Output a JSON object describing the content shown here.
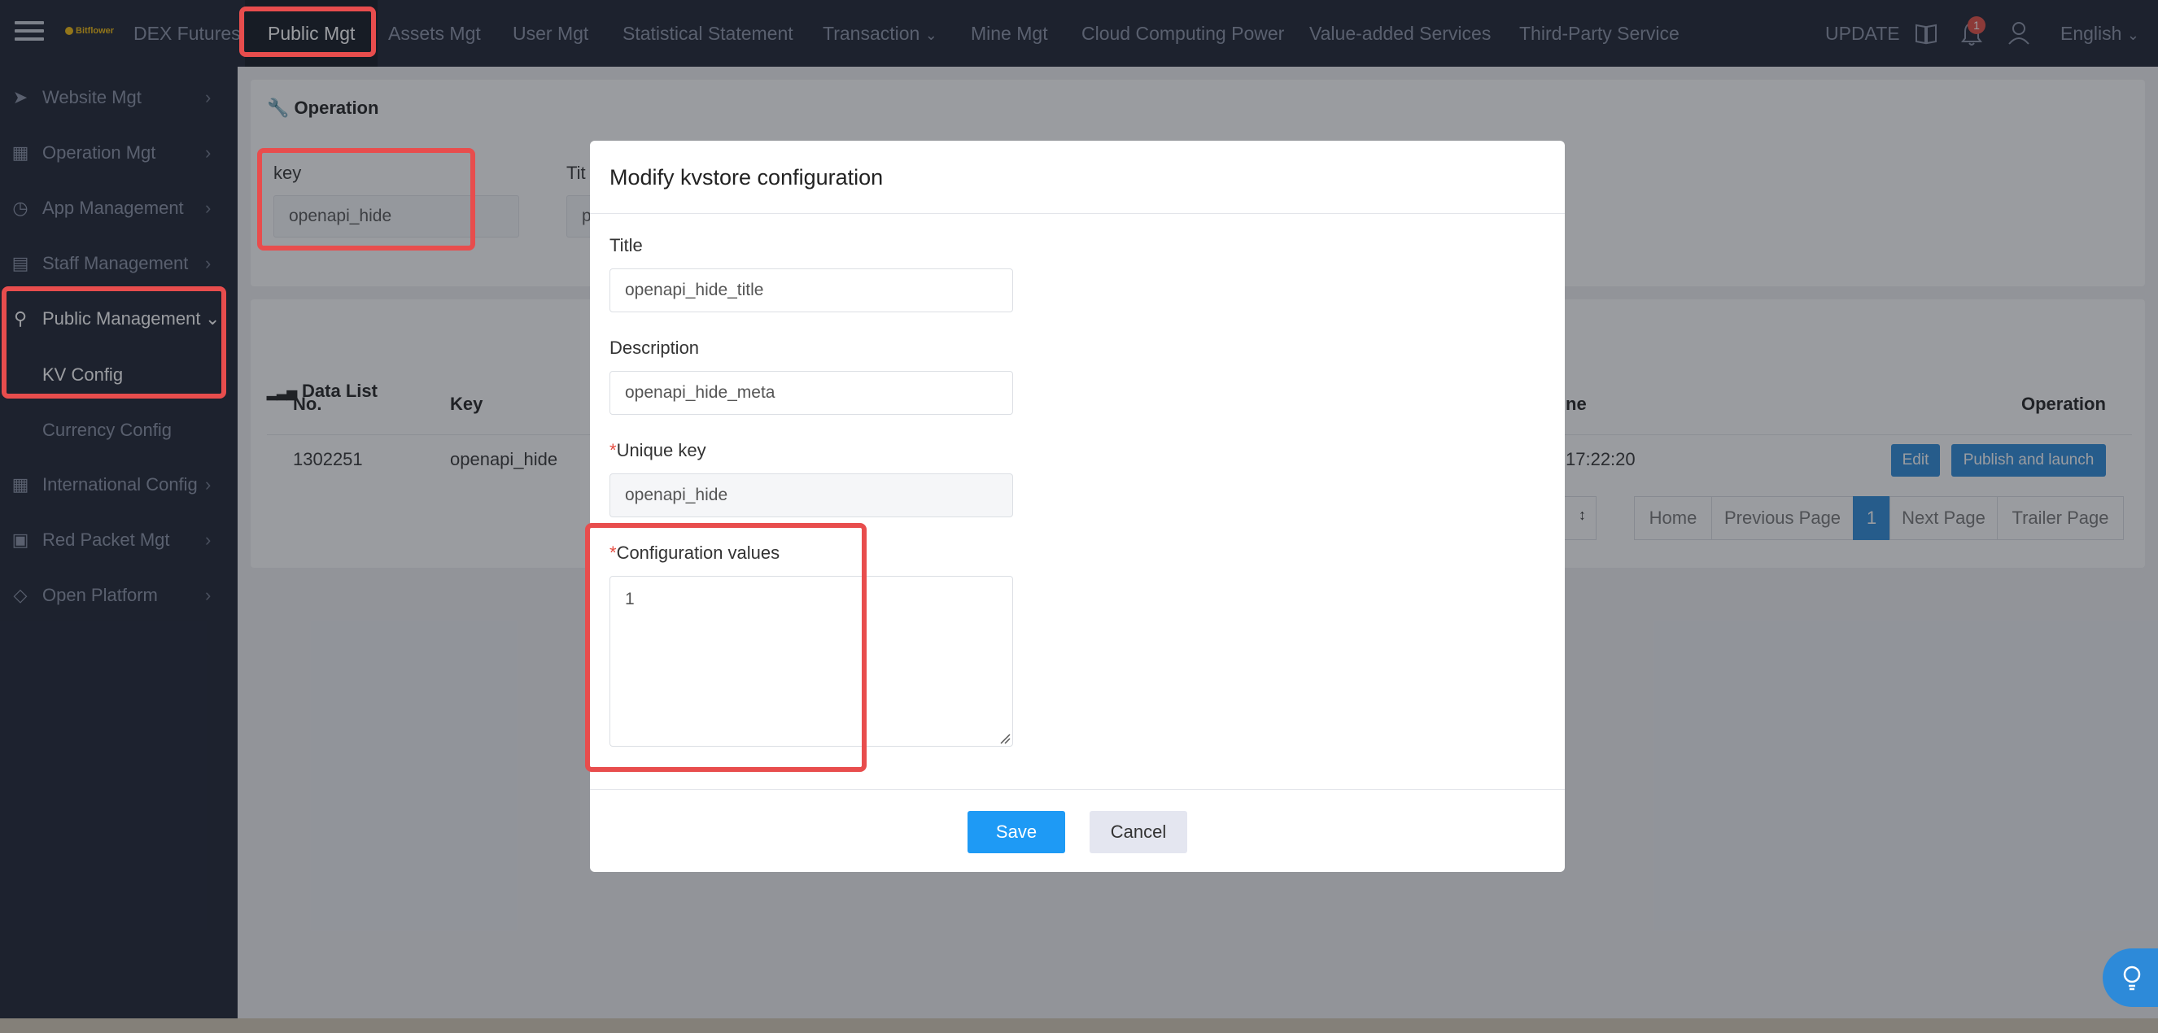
{
  "topnav": {
    "logo_text": "Bitflower",
    "items": [
      "DEX Futures",
      "Public Mgt",
      "Assets Mgt",
      "User Mgt",
      "Statistical Statement",
      "Transaction",
      "Mine Mgt",
      "Cloud Computing Power",
      "Value-added Services",
      "Third-Party Service"
    ],
    "active": "Public Mgt",
    "update_label": "UPDATE",
    "notification_count": "1",
    "language": "English"
  },
  "sidebar": {
    "items": [
      {
        "label": "Website Mgt",
        "icon": "send-icon"
      },
      {
        "label": "Operation Mgt",
        "icon": "bar-chart-icon"
      },
      {
        "label": "App Management",
        "icon": "clock-icon"
      },
      {
        "label": "Staff Management",
        "icon": "table-icon"
      },
      {
        "label": "Public Management",
        "icon": "cart-icon"
      },
      {
        "label": "International Config",
        "icon": "grid-icon"
      },
      {
        "label": "Red Packet Mgt",
        "icon": "image-icon"
      },
      {
        "label": "Open Platform",
        "icon": "diamond-icon"
      }
    ],
    "sub_items": [
      "KV Config",
      "Currency Config"
    ],
    "active_sub": "KV Config"
  },
  "operation": {
    "title": "Operation",
    "key_label": "key",
    "key_value": "openapi_hide",
    "title_label_partial": "Tit",
    "title_value_partial": "p"
  },
  "data_list": {
    "title": "Data List",
    "columns": {
      "no": "No.",
      "key": "Key",
      "time_partial": "ne",
      "operation": "Operation"
    },
    "rows": [
      {
        "no": "1302251",
        "key": "openapi_hide",
        "time_partial": "17:22:20",
        "edit": "Edit",
        "publish": "Publish and launch"
      }
    ],
    "pager": {
      "home": "Home",
      "prev": "Previous Page",
      "current": "1",
      "next": "Next Page",
      "last": "Trailer Page"
    }
  },
  "modal": {
    "title": "Modify kvstore configuration",
    "title_label": "Title",
    "title_value": "openapi_hide_title",
    "description_label": "Description",
    "description_value": "openapi_hide_meta",
    "unique_key_label": "Unique key",
    "unique_key_value": "openapi_hide",
    "config_values_label": "Configuration values",
    "config_values_value": "1",
    "required_mark": "*",
    "save_label": "Save",
    "cancel_label": "Cancel"
  },
  "colors": {
    "nav_bg": "#1c2230",
    "primary": "#1e9af5",
    "highlight": "#e84d4d"
  }
}
